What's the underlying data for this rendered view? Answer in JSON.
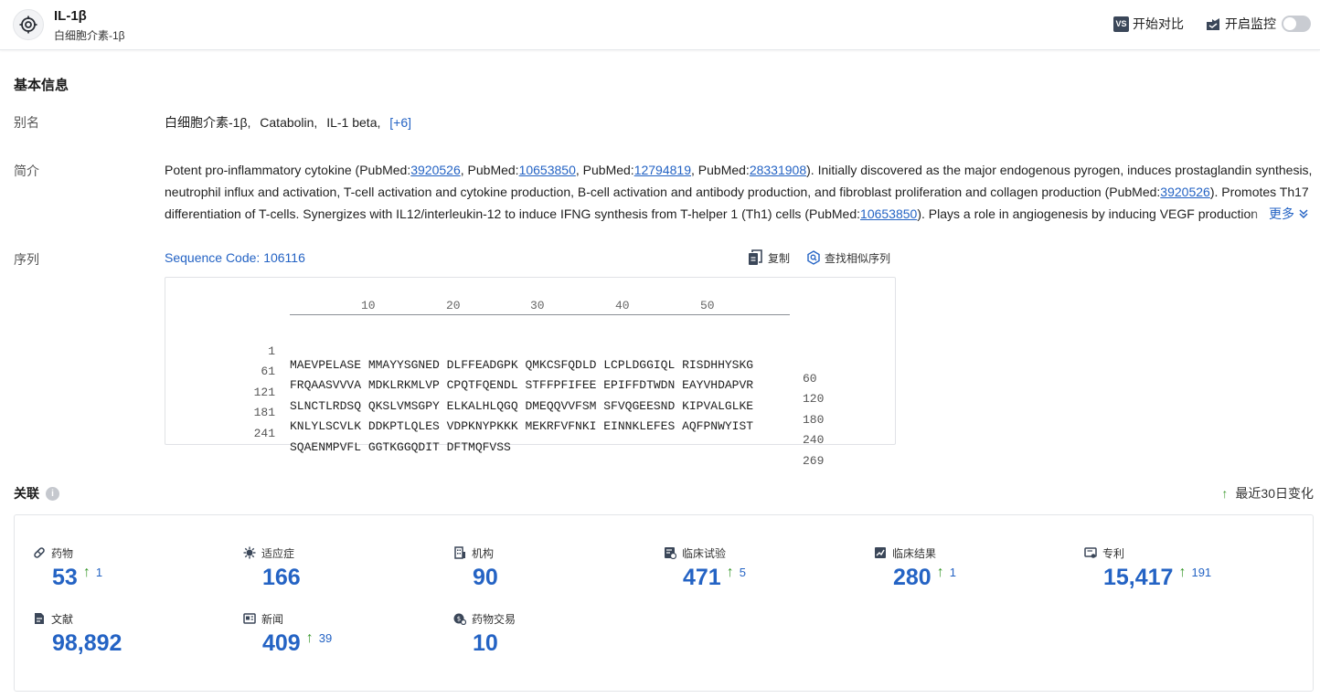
{
  "header": {
    "title": "IL-1β",
    "subtitle": "白细胞介素-1β",
    "compare_label": "开始对比",
    "compare_badge": "VS",
    "monitor_label": "开启监控",
    "monitor_on": false
  },
  "basic": {
    "title": "基本信息",
    "alias_label": "别名",
    "aliases": [
      "白细胞介素-1β,",
      "Catabolin,",
      "IL-1 beta,"
    ],
    "alias_more": "[+6]",
    "intro_label": "简介",
    "intro_lines": [
      [
        {
          "t": "Potent pro-inflammatory cytokine (PubMed:"
        },
        {
          "t": "3920526",
          "link": true
        },
        {
          "t": ", PubMed:"
        },
        {
          "t": "10653850",
          "link": true
        },
        {
          "t": ", PubMed:"
        },
        {
          "t": "12794819",
          "link": true
        },
        {
          "t": ", PubMed:"
        },
        {
          "t": "28331908",
          "link": true
        },
        {
          "t": "). Initially discovered as the major endogenous pyrogen, induces prostaglandin synthesis,"
        }
      ],
      [
        {
          "t": "neutrophil influx and activation, T-cell activation and cytokine production, B-cell activation and antibody production, and fibroblast proliferation and collagen production (PubMed:"
        },
        {
          "t": "3920526",
          "link": true
        },
        {
          "t": "). Promotes Th17"
        }
      ],
      [
        {
          "t": "differentiation of T-cells. Synergizes with IL12/interleukin-12 to induce IFNG synthesis from T-helper 1 (Th1) cells (PubMed:"
        },
        {
          "t": "10653850",
          "link": true
        },
        {
          "t": "). Plays a role in angiogenesis by inducing VEGF production"
        }
      ]
    ],
    "more_label": "更多",
    "seq_label": "序列",
    "seq_code": "Sequence Code: 106116",
    "copy_label": "复制",
    "find_similar_label": "查找相似序列"
  },
  "sequence": {
    "ruler": [
      "10",
      "20",
      "30",
      "40",
      "50"
    ],
    "lines": [
      {
        "start": "1",
        "aa": "MAEVPELASE MMAYYSGNED DLFFEADGPK QMKCSFQDLD LCPLDGGIQL RISDHHYSKG",
        "end": "60"
      },
      {
        "start": "61",
        "aa": "FRQAASVVVA MDKLRKMLVP CPQTFQENDL STFFPFIFEE EPIFFDTWDN EAYVHDAPVR",
        "end": "120"
      },
      {
        "start": "121",
        "aa": "SLNCTLRDSQ QKSLVMSGPY ELKALHLQGQ DMEQQVVFSM SFVQGEESND KIPVALGLKE",
        "end": "180"
      },
      {
        "start": "181",
        "aa": "KNLYLSCVLK DDKPTLQLES VDPKNYPKKK MEKRFVFNKI EINNKLEFES AQFPNWYIST",
        "end": "240"
      },
      {
        "start": "241",
        "aa": "SQAENMPVFL GGTKGGQDIT DFTMQFVSS",
        "end": "269"
      }
    ]
  },
  "association": {
    "title": "关联",
    "info_glyph": "i",
    "recent_label": "最近30日变化",
    "up_glyph": "↑",
    "stats": [
      {
        "label": "药物",
        "value": "53",
        "delta": "1",
        "icon": "pill-icon"
      },
      {
        "label": "适应症",
        "value": "166",
        "delta": "",
        "icon": "virus-icon"
      },
      {
        "label": "机构",
        "value": "90",
        "delta": "",
        "icon": "building-icon"
      },
      {
        "label": "临床试验",
        "value": "471",
        "delta": "5",
        "icon": "clinical-trial-icon"
      },
      {
        "label": "临床结果",
        "value": "280",
        "delta": "1",
        "icon": "clinical-result-icon"
      },
      {
        "label": "专利",
        "value": "15,417",
        "delta": "191",
        "icon": "patent-icon"
      },
      {
        "label": "文献",
        "value": "98,892",
        "delta": "",
        "icon": "document-icon"
      },
      {
        "label": "新闻",
        "value": "409",
        "delta": "39",
        "icon": "news-icon"
      },
      {
        "label": "药物交易",
        "value": "10",
        "delta": "",
        "icon": "drug-deal-icon"
      }
    ]
  },
  "colors": {
    "accent": "#2463c4",
    "up": "#3c9a2e"
  }
}
